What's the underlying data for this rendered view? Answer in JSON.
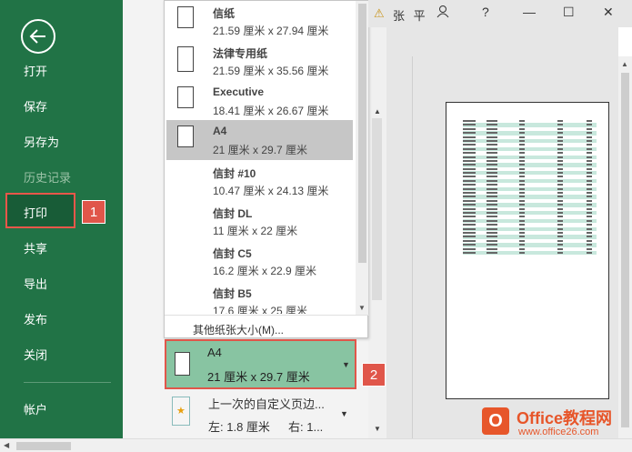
{
  "nav": {
    "items": [
      "打开",
      "保存",
      "另存为",
      "历史记录",
      "打印",
      "共享",
      "导出",
      "发布",
      "关闭",
      "帐户"
    ]
  },
  "badges": [
    "1",
    "2"
  ],
  "paper_sizes": [
    {
      "name": "信纸",
      "size": "21.59 厘米 x 27.94 厘米"
    },
    {
      "name": "法律专用纸",
      "size": "21.59 厘米 x 35.56 厘米"
    },
    {
      "name": "Executive",
      "size": "18.41 厘米 x 26.67 厘米"
    },
    {
      "name": "A4",
      "size": "21 厘米 x 29.7 厘米"
    },
    {
      "name": "信封 #10",
      "size": "10.47 厘米 x 24.13 厘米"
    },
    {
      "name": "信封 DL",
      "size": "11 厘米 x 22 厘米"
    },
    {
      "name": "信封 C5",
      "size": "16.2 厘米 x 22.9 厘米"
    },
    {
      "name": "信封 B5",
      "size": "17.6 厘米 x 25 厘米"
    }
  ],
  "dropdown_footer": "其他纸张大小(M)...",
  "selected_paper": {
    "name": "A4",
    "size": "21 厘米 x 29.7 厘米"
  },
  "margins": {
    "name": "上一次的自定义页边...",
    "left": "左: 1.8 厘米",
    "right": "右: 1..."
  },
  "titlebar": {
    "user": "张 平",
    "help": "?"
  },
  "watermark": {
    "brand": "Office教程网",
    "url": "www.office26.com"
  },
  "colors": {
    "accent": "#217346",
    "highlight": "#e0564a"
  }
}
